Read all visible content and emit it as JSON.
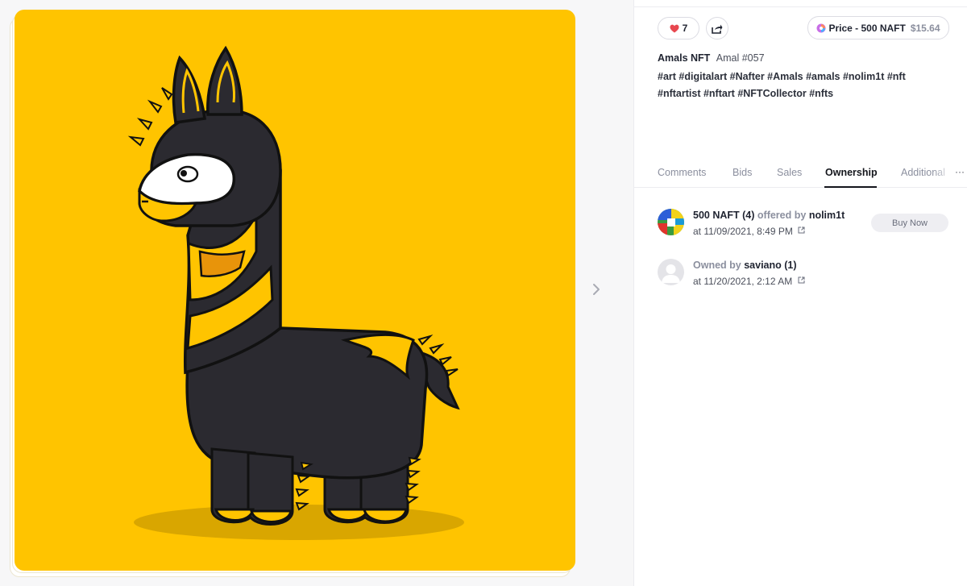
{
  "nav": {
    "next_icon": "chevron-right-icon"
  },
  "artwork": {
    "background_color": "#ffc400",
    "subject": "llama",
    "icon": "llama-illustration"
  },
  "actions": {
    "like_count": "7",
    "like_icon": "heart-icon",
    "share_icon": "share-icon",
    "price_label": "Price - 500 NAFT",
    "price_usd": "$15.64",
    "price_icon": "naft-token-icon"
  },
  "item": {
    "collection": "Amals NFT",
    "name": "Amal #057",
    "tags_line1": "#art #digitalart #Nafter #Amals #amals #nolim1t #nft",
    "tags_line2": "#nftartist #nftart #NFTCollector #nfts"
  },
  "tabs": [
    {
      "label": "Comments",
      "active": false
    },
    {
      "label": "Bids",
      "active": false
    },
    {
      "label": "Sales",
      "active": false
    },
    {
      "label": "Ownership",
      "active": true
    },
    {
      "label": "Additional",
      "active": false
    }
  ],
  "tabs_more": "···",
  "ownership": [
    {
      "amount": "500 NAFT (4)",
      "relation": "offered by",
      "user": "nolim1t",
      "date": "at 11/09/2021, 8:49 PM",
      "action": "Buy Now"
    },
    {
      "relation": "Owned by",
      "user": "saviano (1)",
      "date": "at 11/20/2021, 2:12 AM"
    }
  ],
  "colors": {
    "accent": "#ffc400",
    "heart": "#e8474f",
    "text": "#1f2330",
    "muted": "#8b8f9e"
  }
}
